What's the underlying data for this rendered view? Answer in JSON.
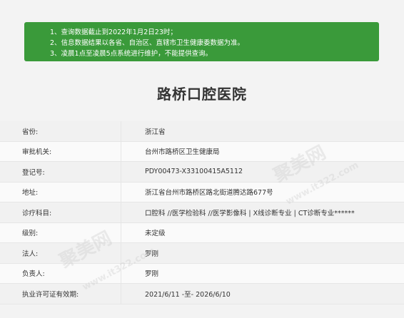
{
  "notice": {
    "lines": [
      "1、查询数据截止到2022年1月2日23时；",
      "2、信息数据结果以各省、自治区、直辖市卫生健康委数据为准。",
      "3、凌晨1点至凌晨5点系统进行维护，不能提供查询。"
    ]
  },
  "hospital": {
    "name": "路桥口腔医院"
  },
  "fields": [
    {
      "label": "省份:",
      "value": "浙江省"
    },
    {
      "label": "审批机关:",
      "value": "台州市路桥区卫生健康局"
    },
    {
      "label": "登记号:",
      "value": "PDY00473-X33100415A5112"
    },
    {
      "label": "地址:",
      "value": "浙江省台州市路桥区路北街道腾达路677号"
    },
    {
      "label": "诊疗科目:",
      "value": "口腔科 //医学检验科 //医学影像科 | X线诊断专业 | CT诊断专业******"
    },
    {
      "label": "级别:",
      "value": "未定级"
    },
    {
      "label": "法人:",
      "value": "罗刚"
    },
    {
      "label": "负责人:",
      "value": "罗刚"
    },
    {
      "label": "执业许可证有效期:",
      "value": "2021/6/11 -至- 2026/6/10"
    }
  ],
  "watermark": {
    "text": "聚美网",
    "url": "www.it322.com"
  }
}
